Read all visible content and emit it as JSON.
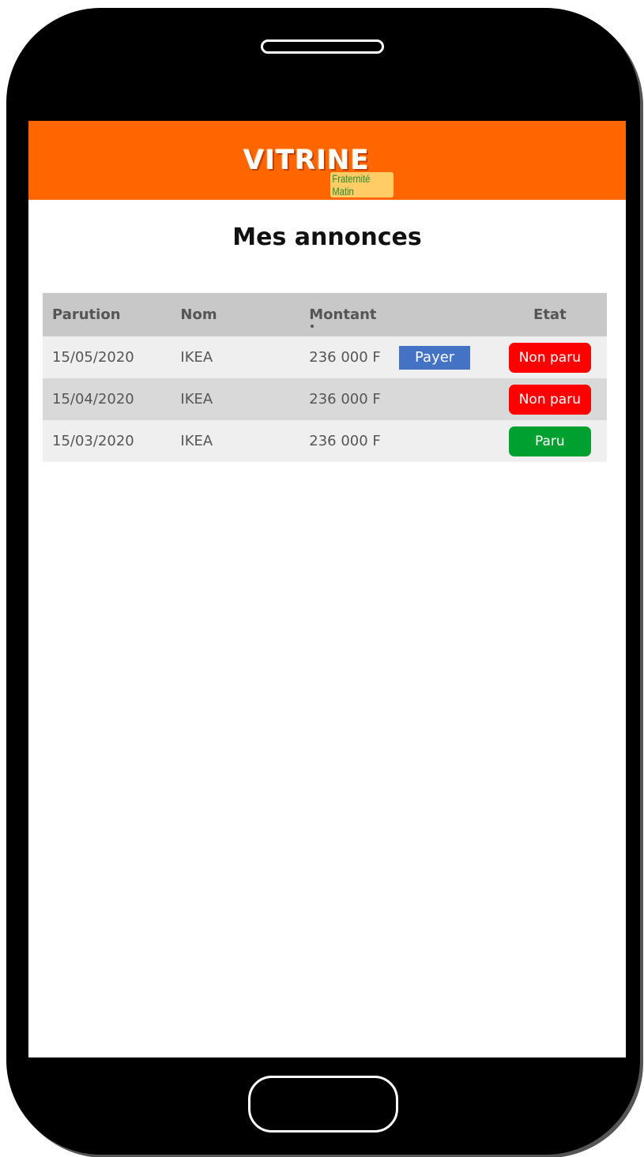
{
  "app": {
    "logo_text": "VITRINE",
    "logo_subtitle": "Fraternité Matin",
    "brand_color": "#ff6600"
  },
  "page": {
    "title": "Mes annonces"
  },
  "table": {
    "headers": {
      "parution": "Parution",
      "nom": "Nom",
      "montant": "Montant",
      "etat": "Etat"
    },
    "rows": [
      {
        "parution": "15/05/2020",
        "nom": "IKEA",
        "montant": "236 000 F",
        "action": "Payer",
        "etat": "Non paru",
        "etat_color": "#ff0000"
      },
      {
        "parution": "15/04/2020",
        "nom": "IKEA",
        "montant": "236 000 F",
        "action": "",
        "etat": "Non paru",
        "etat_color": "#ff0000"
      },
      {
        "parution": "15/03/2020",
        "nom": "IKEA",
        "montant": "236 000 F",
        "action": "",
        "etat": "Paru",
        "etat_color": "#00a030"
      }
    ]
  }
}
